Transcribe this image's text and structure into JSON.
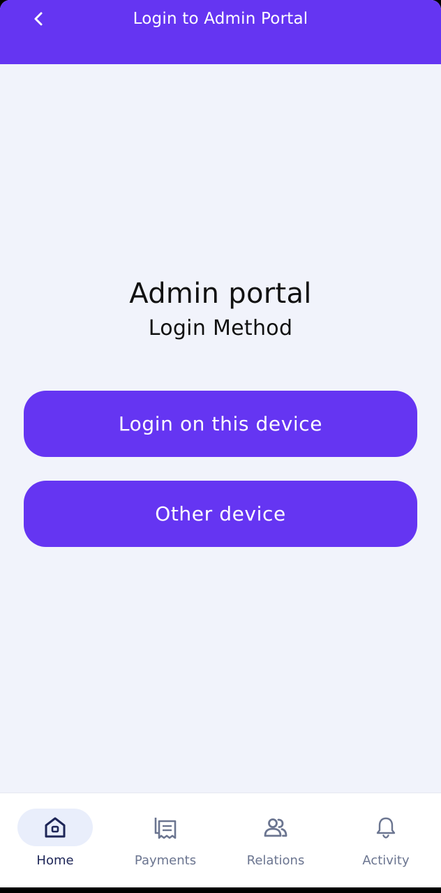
{
  "header": {
    "title": "Login to Admin Portal",
    "back_icon": "chevron-left-icon"
  },
  "main": {
    "heading": "Admin portal",
    "subheading": "Login Method",
    "buttons": {
      "this_device": "Login on this device",
      "other_device": "Other device"
    }
  },
  "bottom_nav": {
    "active": "Home",
    "items": [
      {
        "label": "Home",
        "icon": "home-icon"
      },
      {
        "label": "Payments",
        "icon": "receipt-icon"
      },
      {
        "label": "Relations",
        "icon": "people-icon"
      },
      {
        "label": "Activity",
        "icon": "bell-icon"
      }
    ]
  },
  "colors": {
    "accent": "#6535f2",
    "background": "#f1f3fb",
    "nav_active_pill": "#e9eefb",
    "nav_active_text": "#1d2557",
    "nav_inactive": "#6b7590"
  }
}
